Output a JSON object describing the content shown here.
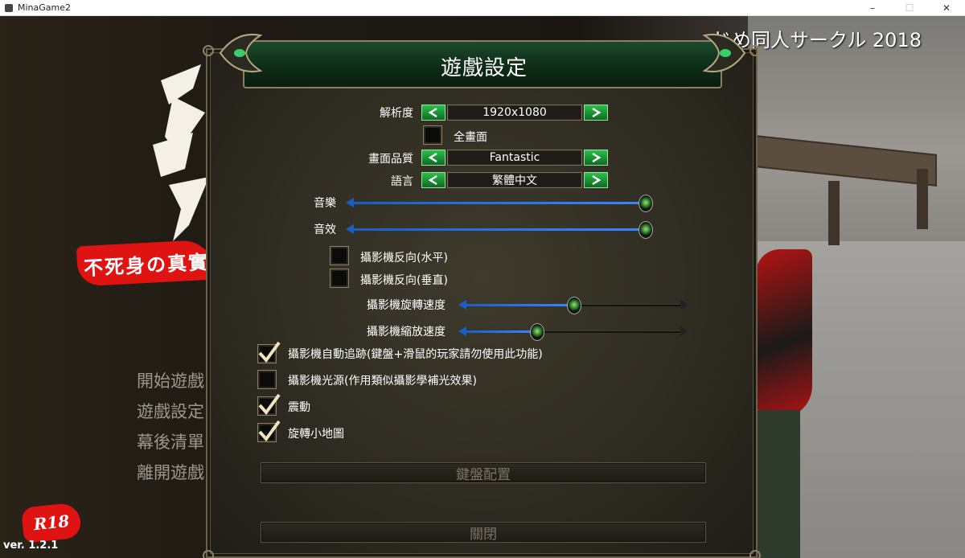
{
  "window": {
    "title": "MinaGame2"
  },
  "background": {
    "credit": "じめ同人サークル 2018",
    "subtitle": "不死身の真實",
    "menu_items": [
      "開始遊戲",
      "遊戲設定",
      "幕後清單",
      "離開遊戲"
    ],
    "badge": "R18",
    "version": "ver. 1.2.1"
  },
  "dialog": {
    "title": "遊戲設定",
    "resolution": {
      "label": "解析度",
      "value": "1920x1080"
    },
    "fullscreen": {
      "label": "全畫面",
      "checked": false
    },
    "quality": {
      "label": "畫面品質",
      "value": "Fantastic"
    },
    "language": {
      "label": "語言",
      "value": "繁體中文"
    },
    "music": {
      "label": "音樂",
      "level": 1.0
    },
    "sfx": {
      "label": "音效",
      "level": 1.0
    },
    "invert_h": {
      "label": "攝影機反向(水平)",
      "checked": false
    },
    "invert_v": {
      "label": "攝影機反向(垂直)",
      "checked": false
    },
    "rotate_speed": {
      "label": "攝影機旋轉速度",
      "level": 0.5
    },
    "zoom_speed": {
      "label": "攝影機縮放速度",
      "level": 0.33
    },
    "auto_follow": {
      "label": "攝影機自動追跡(鍵盤+滑鼠的玩家請勿使用此功能)",
      "checked": true
    },
    "camera_light": {
      "label": "攝影機光源(作用類似攝影學補光效果)",
      "checked": false
    },
    "vibration": {
      "label": "震動",
      "checked": true
    },
    "rotate_minimap": {
      "label": "旋轉小地圖",
      "checked": true
    },
    "keyboard_button": "鍵盤配置",
    "close_button": "關閉"
  },
  "colors": {
    "accent_green": "#2bbf4a",
    "slider_blue": "#1b5ec4",
    "badge_red": "#e01313"
  }
}
